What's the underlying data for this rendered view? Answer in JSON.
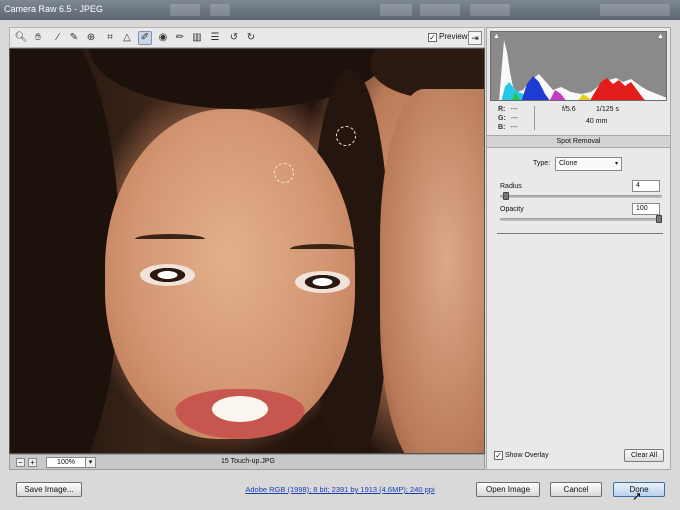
{
  "window": {
    "title": "Camera Raw 6.5  -  JPEG"
  },
  "toolbar": {
    "tools": [
      {
        "name": "zoom-icon",
        "glyph": "🔍︎"
      },
      {
        "name": "hand-icon",
        "glyph": "✋︎"
      },
      {
        "name": "white-balance-icon",
        "glyph": "⁄"
      },
      {
        "name": "color-sampler-icon",
        "glyph": "✎"
      },
      {
        "name": "target-adjustment-icon",
        "glyph": "⊕"
      },
      {
        "name": "crop-icon",
        "glyph": "⌗"
      },
      {
        "name": "straighten-icon",
        "glyph": "△"
      },
      {
        "name": "spot-removal-icon",
        "glyph": "✐"
      },
      {
        "name": "red-eye-icon",
        "glyph": "◉"
      },
      {
        "name": "adjustment-brush-icon",
        "glyph": "✏"
      },
      {
        "name": "graduated-filter-icon",
        "glyph": "▥"
      },
      {
        "name": "preferences-icon",
        "glyph": "☰"
      },
      {
        "name": "rotate-left-icon",
        "glyph": "↺"
      },
      {
        "name": "rotate-right-icon",
        "glyph": "↻"
      }
    ],
    "preview_label": "Preview",
    "preview_checked": "✓",
    "fullscreen_glyph": "⇥"
  },
  "status": {
    "zoom_out": "−",
    "zoom_in": "+",
    "zoom_level": "100%",
    "zoom_dropdown": "▾",
    "filename": "15 Touch-up.JPG"
  },
  "panel": {
    "clip_shadow": "▲",
    "clip_highlight": "▲",
    "readout": {
      "r_label": "R:",
      "g_label": "G:",
      "b_label": "B:",
      "r": "---",
      "g": "---",
      "b": "---"
    },
    "exif": {
      "aperture": "f/5.6",
      "shutter": "1/125 s",
      "focal_length": "40 mm"
    },
    "section_title": "Spot Removal",
    "type_label": "Type:",
    "type_value": "Clone",
    "type_dropdown": "▾",
    "radius_label": "Radius",
    "radius_value": "4",
    "radius_fraction": 0.02,
    "opacity_label": "Opacity",
    "opacity_value": "100",
    "opacity_fraction": 1.0,
    "show_overlay_label": "Show Overlay",
    "show_overlay_checked": "✓",
    "clear_all_label": "Clear All"
  },
  "footer": {
    "save_image_label": "Save Image...",
    "workflow_info": "Adobe RGB (1998); 8 bit; 2391 by 1913 (4.6MP); 240 ppi",
    "open_image_label": "Open Image",
    "cancel_label": "Cancel",
    "done_label": "Done"
  },
  "colors": {
    "accent": "#3b6ea5",
    "link": "#1a3fb5"
  }
}
